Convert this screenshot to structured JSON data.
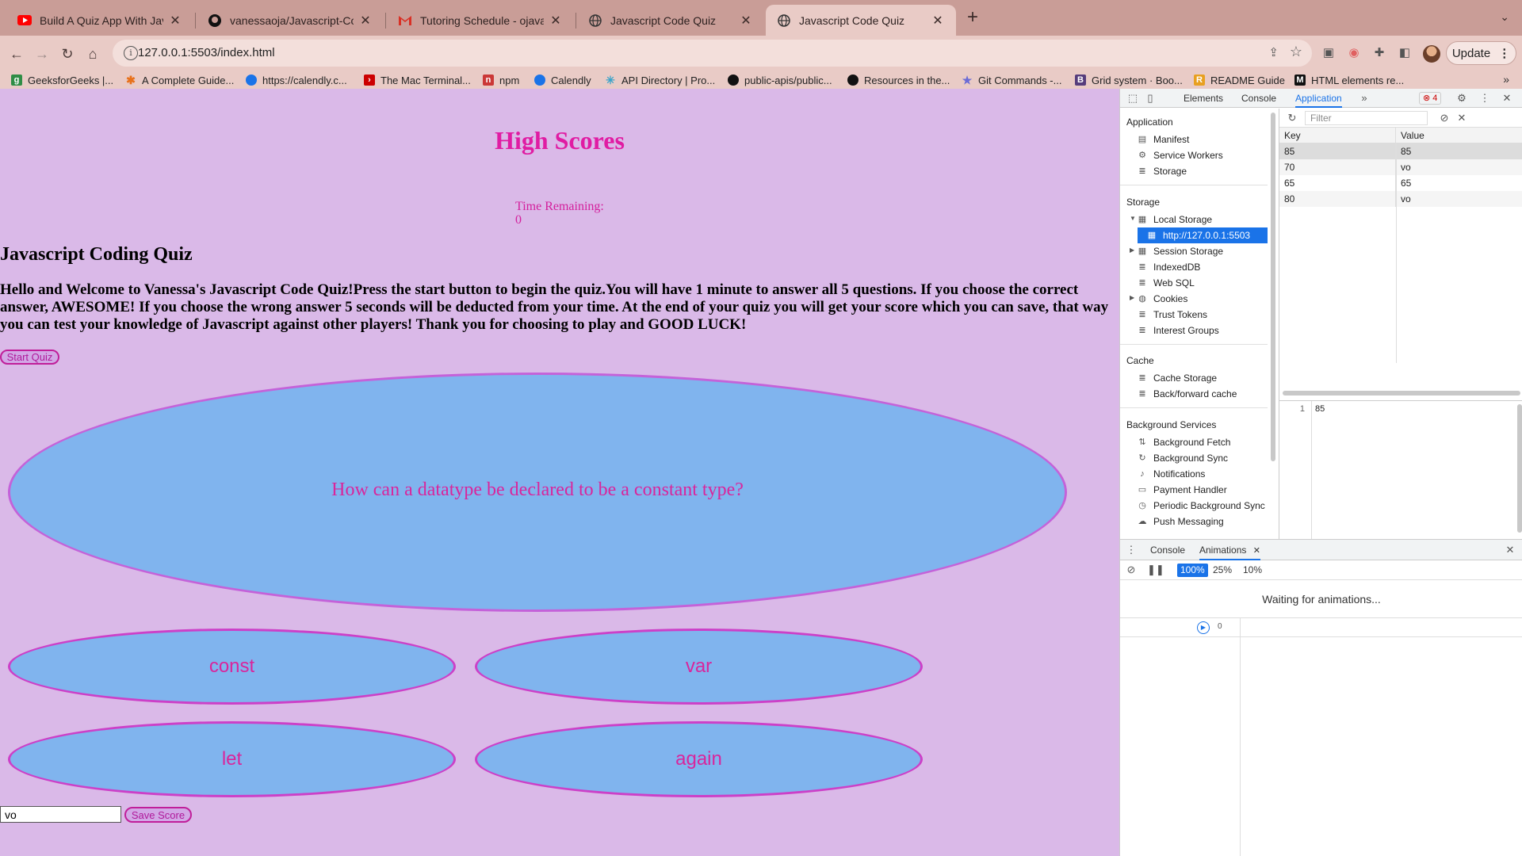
{
  "browser": {
    "tabs": [
      {
        "title": "Build A Quiz App With JavaScri",
        "icon": "youtube-icon",
        "color": "#ff0000"
      },
      {
        "title": "vanessaoja/Javascript-Code-Q",
        "icon": "github-icon",
        "color": "#000000"
      },
      {
        "title": "Tutoring Schedule - ojavaness",
        "icon": "gmail-icon",
        "color": "#d93025"
      },
      {
        "title": "Javascript Code Quiz",
        "icon": "globe-icon",
        "color": "#333333"
      },
      {
        "title": "Javascript Code Quiz",
        "icon": "globe-icon",
        "color": "#333333",
        "active": true
      }
    ],
    "url": "127.0.0.1:5503/index.html",
    "update_label": "Update",
    "bookmarks": [
      "GeeksforGeeks |...",
      "A Complete Guide...",
      "https://calendly.c...",
      "The Mac Terminal...",
      "npm",
      "Calendly",
      "API Directory | Pro...",
      "public-apis/public...",
      "Resources in the...",
      "Git Commands -...",
      "Grid system · Boo...",
      "README Guide",
      "HTML elements re..."
    ]
  },
  "page": {
    "high_scores_title": "High Scores",
    "time_label": "Time Remaining:",
    "time_value": "0",
    "quiz_title": "Javascript Coding Quiz",
    "intro": "Hello and Welcome to Vanessa's Javascript Code Quiz!Press the start button to begin the quiz.You will have 1 minute to answer all 5 questions. If you choose the correct answer, AWESOME! If you choose the wrong answer 5 seconds will be deducted from your time. At the end of your quiz you will get your score which you can save, that way you can test your knowledge of Javascript against other players! Thank you for choosing to play and GOOD LUCK!",
    "start_label": "Start Quiz",
    "question": "How can a datatype be declared to be a constant type?",
    "answers": [
      "const",
      "var",
      "let",
      "again"
    ],
    "name_value": "vo",
    "save_label": "Save Score",
    "accent_color": "#e01ca3",
    "background_color": "#dab9e8",
    "box_color": "#80b4ee"
  },
  "devtools": {
    "tabs": [
      "Elements",
      "Console",
      "Application"
    ],
    "active_tab": "Application",
    "error_count": "4",
    "sidebar": {
      "application_header": "Application",
      "application_items": [
        "Manifest",
        "Service Workers",
        "Storage"
      ],
      "storage_header": "Storage",
      "storage_items": [
        "Local Storage",
        "http://127.0.0.1:5503",
        "Session Storage",
        "IndexedDB",
        "Web SQL",
        "Cookies",
        "Trust Tokens",
        "Interest Groups"
      ],
      "cache_header": "Cache",
      "cache_items": [
        "Cache Storage",
        "Back/forward cache"
      ],
      "bg_header": "Background Services",
      "bg_items": [
        "Background Fetch",
        "Background Sync",
        "Notifications",
        "Payment Handler",
        "Periodic Background Sync",
        "Push Messaging"
      ]
    },
    "filter_placeholder": "Filter",
    "table": {
      "key_header": "Key",
      "value_header": "Value",
      "rows": [
        {
          "key": "85",
          "value": "85"
        },
        {
          "key": "70",
          "value": "vo"
        },
        {
          "key": "65",
          "value": "65"
        },
        {
          "key": "80",
          "value": "vo"
        }
      ]
    },
    "preview": {
      "line_number": "1",
      "text": "85"
    },
    "drawer": {
      "tabs": [
        "Console",
        "Animations"
      ],
      "speeds": [
        "100%",
        "25%",
        "10%"
      ],
      "waiting_text": "Waiting for animations...",
      "timeline_zero": "0"
    }
  }
}
